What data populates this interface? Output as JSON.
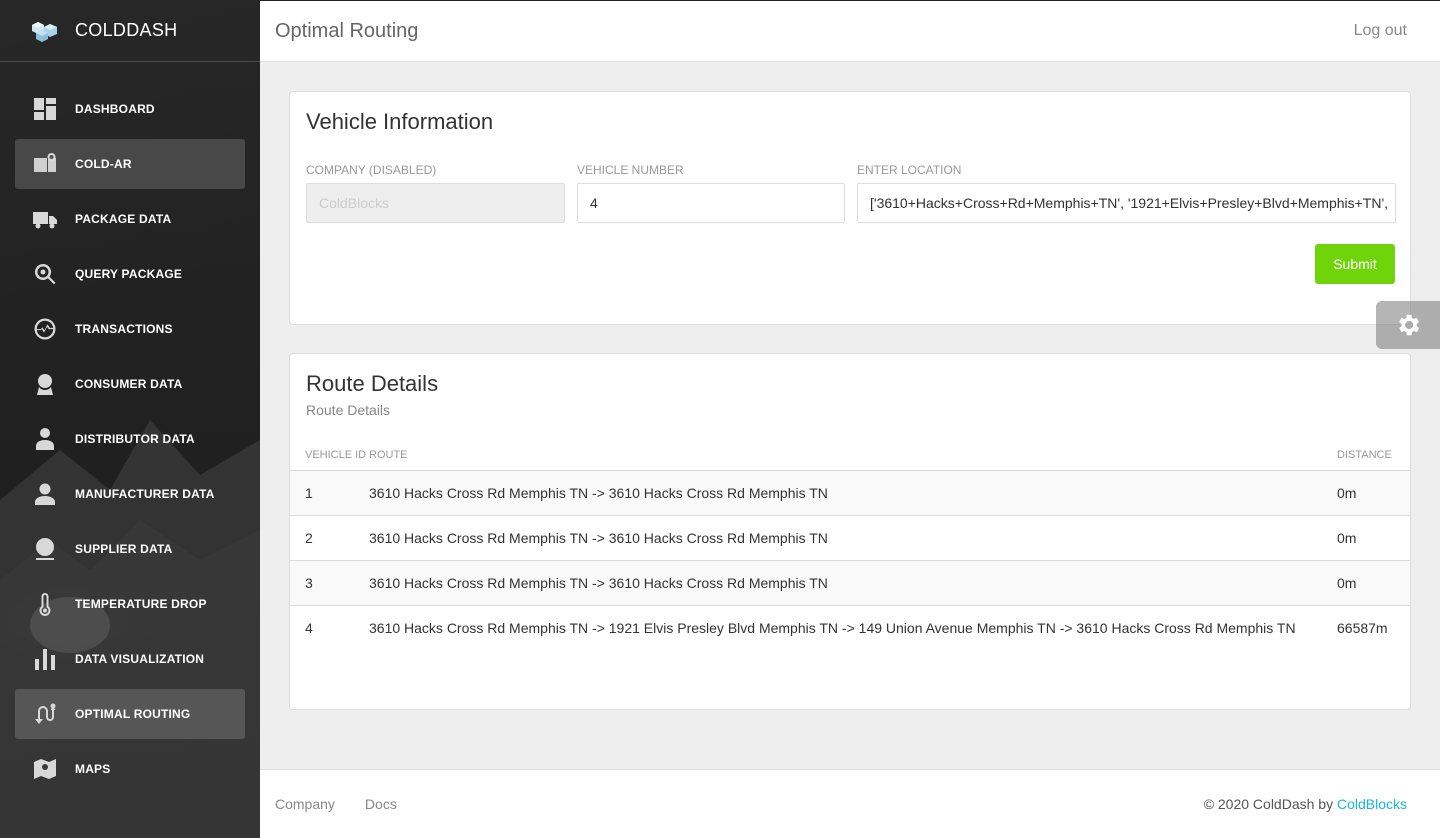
{
  "app": {
    "name": "COLDDASH"
  },
  "sidebar": {
    "items": [
      {
        "label": "DASHBOARD",
        "icon": "dashboard-icon"
      },
      {
        "label": "COLD-AR",
        "icon": "ar-camera-icon"
      },
      {
        "label": "PACKAGE DATA",
        "icon": "truck-icon"
      },
      {
        "label": "QUERY PACKAGE",
        "icon": "search-icon"
      },
      {
        "label": "TRANSACTIONS",
        "icon": "activity-icon"
      },
      {
        "label": "CONSUMER DATA",
        "icon": "user-face-icon"
      },
      {
        "label": "DISTRIBUTOR DATA",
        "icon": "person-icon"
      },
      {
        "label": "MANUFACTURER DATA",
        "icon": "person-icon"
      },
      {
        "label": "SUPPLIER DATA",
        "icon": "person-circle-icon"
      },
      {
        "label": "TEMPERATURE DROP",
        "icon": "thermometer-icon"
      },
      {
        "label": "DATA VISUALIZATION",
        "icon": "bar-chart-icon"
      },
      {
        "label": "OPTIMAL ROUTING",
        "icon": "route-icon"
      },
      {
        "label": "MAPS",
        "icon": "map-icon"
      }
    ],
    "active_items": [
      "COLD-AR",
      "OPTIMAL ROUTING"
    ]
  },
  "header": {
    "title": "Optimal Routing",
    "logout_label": "Log out"
  },
  "vehicle_card": {
    "title": "Vehicle Information",
    "company_label": "COMPANY (DISABLED)",
    "company_value": "ColdBlocks",
    "vehicle_label": "VEHICLE NUMBER",
    "vehicle_value": "4",
    "location_label": "ENTER LOCATION",
    "location_value": "['3610+Hacks+Cross+Rd+Memphis+TN', '1921+Elvis+Presley+Blvd+Memphis+TN',",
    "submit_label": "Submit"
  },
  "route_card": {
    "title": "Route Details",
    "subtitle": "Route Details",
    "columns": [
      "VEHICLE ID",
      "ROUTE",
      "DISTANCE"
    ],
    "rows": [
      {
        "id": "1",
        "route": "3610 Hacks Cross Rd Memphis TN -> 3610 Hacks Cross Rd Memphis TN",
        "distance": "0m"
      },
      {
        "id": "2",
        "route": "3610 Hacks Cross Rd Memphis TN -> 3610 Hacks Cross Rd Memphis TN",
        "distance": "0m"
      },
      {
        "id": "3",
        "route": "3610 Hacks Cross Rd Memphis TN -> 3610 Hacks Cross Rd Memphis TN",
        "distance": "0m"
      },
      {
        "id": "4",
        "route": "3610 Hacks Cross Rd Memphis TN -> 1921 Elvis Presley Blvd Memphis TN -> 149 Union Avenue Memphis TN -> 3610 Hacks Cross Rd Memphis TN",
        "distance": "66587m"
      }
    ]
  },
  "footer": {
    "links": [
      "Company",
      "Docs"
    ],
    "copyright_prefix": "© 2020 ColdDash by",
    "copyright_link": "ColdBlocks"
  },
  "colors": {
    "accent_green": "#6fd40a",
    "link_cyan": "#1ab8d6",
    "sidebar_dark": "#2a2a2a"
  }
}
